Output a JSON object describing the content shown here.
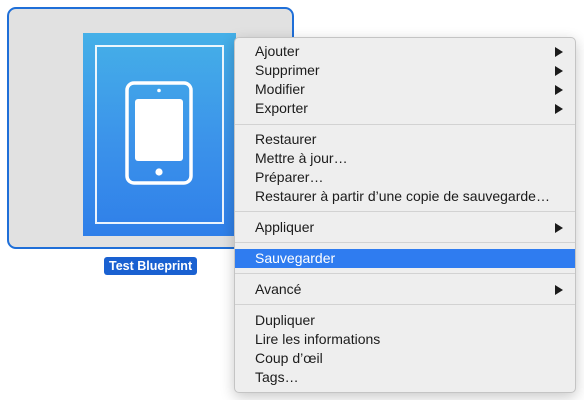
{
  "blueprint": {
    "name": "Test Blueprint"
  },
  "menu": {
    "items": [
      {
        "label": "Ajouter",
        "submenu": true
      },
      {
        "label": "Supprimer",
        "submenu": true
      },
      {
        "label": "Modifier",
        "submenu": true
      },
      {
        "label": "Exporter",
        "submenu": true
      },
      {
        "label": "Restaurer",
        "submenu": false
      },
      {
        "label": "Mettre à jour…",
        "submenu": false
      },
      {
        "label": "Préparer…",
        "submenu": false
      },
      {
        "label": "Restaurer à partir d’une copie de sauvegarde…",
        "submenu": false
      },
      {
        "label": "Appliquer",
        "submenu": true
      },
      {
        "label": "Sauvegarder",
        "submenu": false,
        "highlighted": true
      },
      {
        "label": "Avancé",
        "submenu": true
      },
      {
        "label": "Dupliquer",
        "submenu": false
      },
      {
        "label": "Lire les informations",
        "submenu": false
      },
      {
        "label": "Coup d’œil",
        "submenu": false
      },
      {
        "label": "Tags…",
        "submenu": false
      }
    ]
  },
  "colors": {
    "selection": "#1f6fd8",
    "highlight": "#2f7cf0",
    "thumbnail_top": "#45b0e8",
    "thumbnail_bottom": "#2f7fe9"
  }
}
